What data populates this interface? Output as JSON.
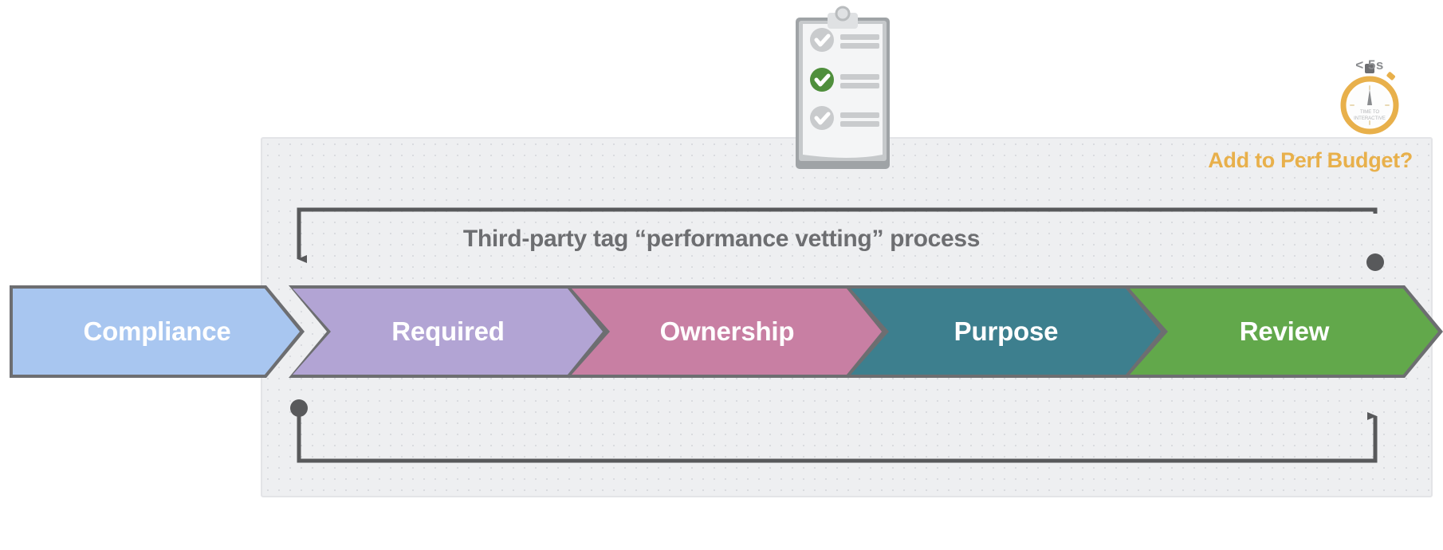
{
  "diagram": {
    "title": "Third-party tag “performance vetting” process",
    "side_label": "Add to Perf Budget?",
    "accent_color": "#e8b04b",
    "text_color": "#6d6e71",
    "panel_color": "#eeeff1"
  },
  "stages": [
    {
      "label": "Compliance",
      "color": "#a8c6f0",
      "border": "#6d6e71",
      "text_color": "#ffffff"
    },
    {
      "label": "Required",
      "color": "#b2a4d4",
      "border": "#6d6e71",
      "text_color": "#ffffff"
    },
    {
      "label": "Ownership",
      "color": "#c87fa3",
      "border": "#6d6e71",
      "text_color": "#ffffff"
    },
    {
      "label": "Purpose",
      "color": "#3d7f8e",
      "border": "#6d6e71",
      "text_color": "#ffffff"
    },
    {
      "label": "Review",
      "color": "#62a84b",
      "border": "#6d6e71",
      "text_color": "#ffffff"
    }
  ],
  "icons": {
    "clipboard": {
      "name": "clipboard-checklist-icon",
      "checked_item_color": "#4f8f3c",
      "unchecked_item_color": "#c9cbcd"
    },
    "stopwatch": {
      "name": "stopwatch-icon",
      "threshold_label": "< 5s",
      "face_line_1": "TIME TO",
      "face_line_2": "INTERACTIVE",
      "color": "#e8b04b"
    }
  },
  "connectors": {
    "top": {
      "from": "Review",
      "to": "Compliance",
      "arrow_end": "left",
      "dot_end": "right"
    },
    "bottom": {
      "from": "Compliance",
      "to": "Review",
      "arrow_end": "right",
      "dot_end": "left"
    },
    "line_color": "#58595b"
  }
}
